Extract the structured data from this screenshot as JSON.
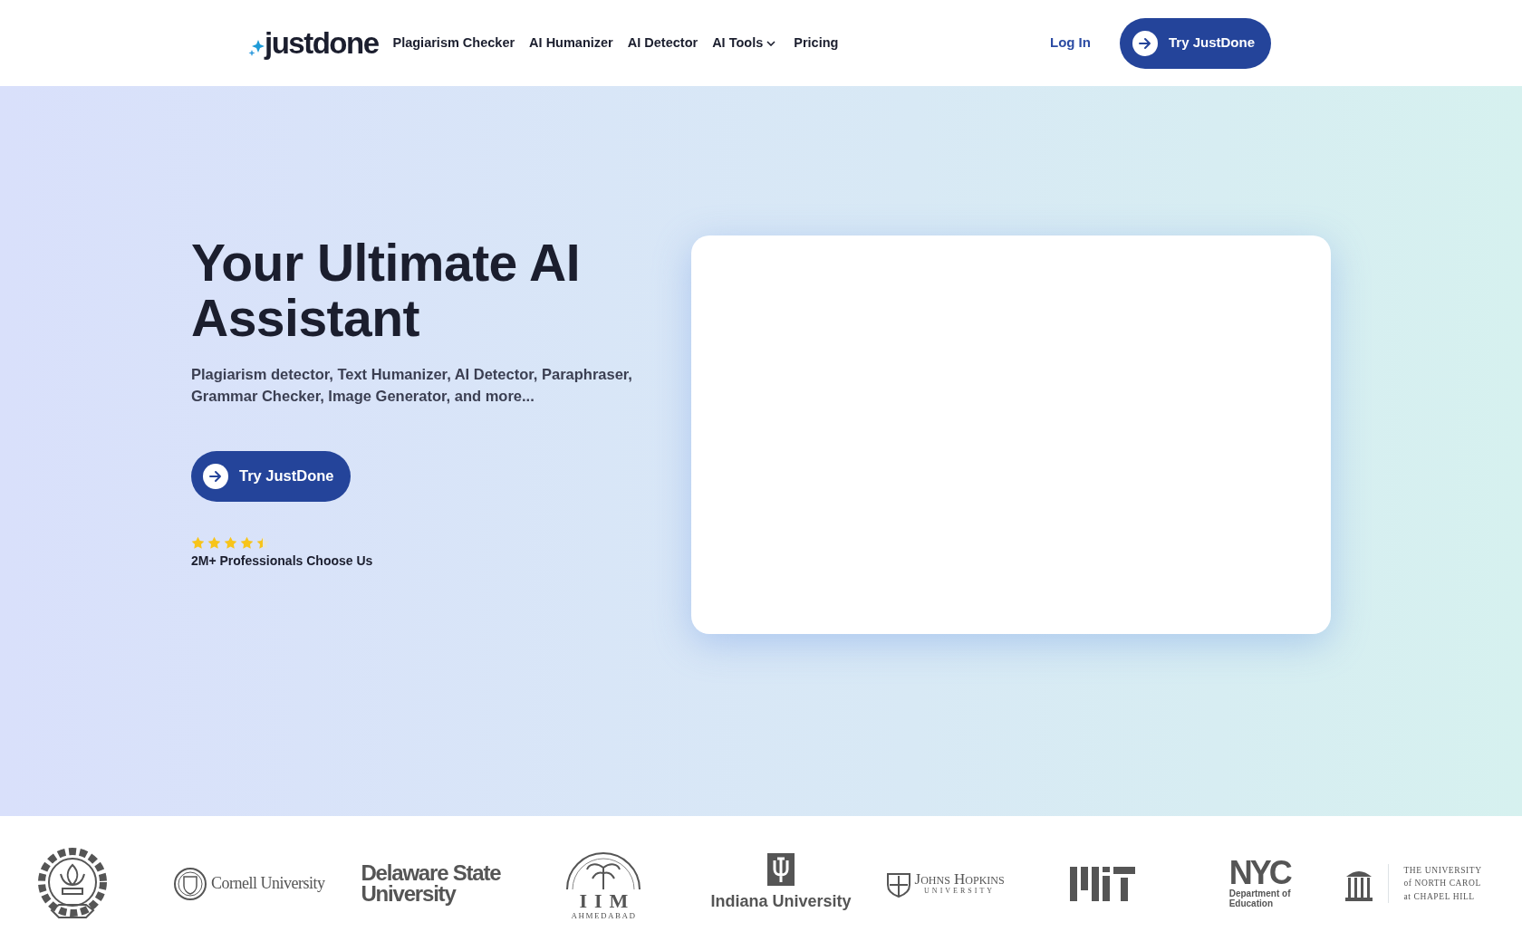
{
  "header": {
    "logo": "justdone",
    "nav": [
      {
        "label": "Plagiarism Checker",
        "dropdown": false
      },
      {
        "label": "AI Humanizer",
        "dropdown": false
      },
      {
        "label": "AI Detector",
        "dropdown": false
      },
      {
        "label": "AI Tools",
        "dropdown": true
      },
      {
        "label": "Pricing",
        "dropdown": false
      }
    ],
    "login": "Log In",
    "cta": "Try JustDone"
  },
  "hero": {
    "title": "Your Ultimate AI Assistant",
    "subtitle": "Plagiarism detector, Text Humanizer, AI Detector, Paraphraser, Grammar Checker, Image Generator, and more...",
    "cta": "Try JustDone",
    "stars": 4.5,
    "tagline": "2M+ Professionals Choose Us"
  },
  "logos": [
    {
      "kind": "emblem"
    },
    {
      "kind": "seal",
      "lines": [
        "Cornell University"
      ]
    },
    {
      "kind": "wordmark",
      "lines": [
        "Delaware State",
        "University"
      ]
    },
    {
      "kind": "iim",
      "lines": [
        "IIM",
        "AHMEDABAD"
      ]
    },
    {
      "kind": "trident",
      "lines": [
        "Indiana University"
      ]
    },
    {
      "kind": "shield",
      "lines": [
        "Johns Hopkins",
        "UNIVERSITY"
      ]
    },
    {
      "kind": "mit"
    },
    {
      "kind": "nyc",
      "lines": [
        "NYC",
        "Department of",
        "Education"
      ]
    },
    {
      "kind": "unc",
      "lines": [
        "THE UNIVERSITY",
        "of NORTH CAROL",
        "at CHAPEL HILL"
      ]
    }
  ]
}
